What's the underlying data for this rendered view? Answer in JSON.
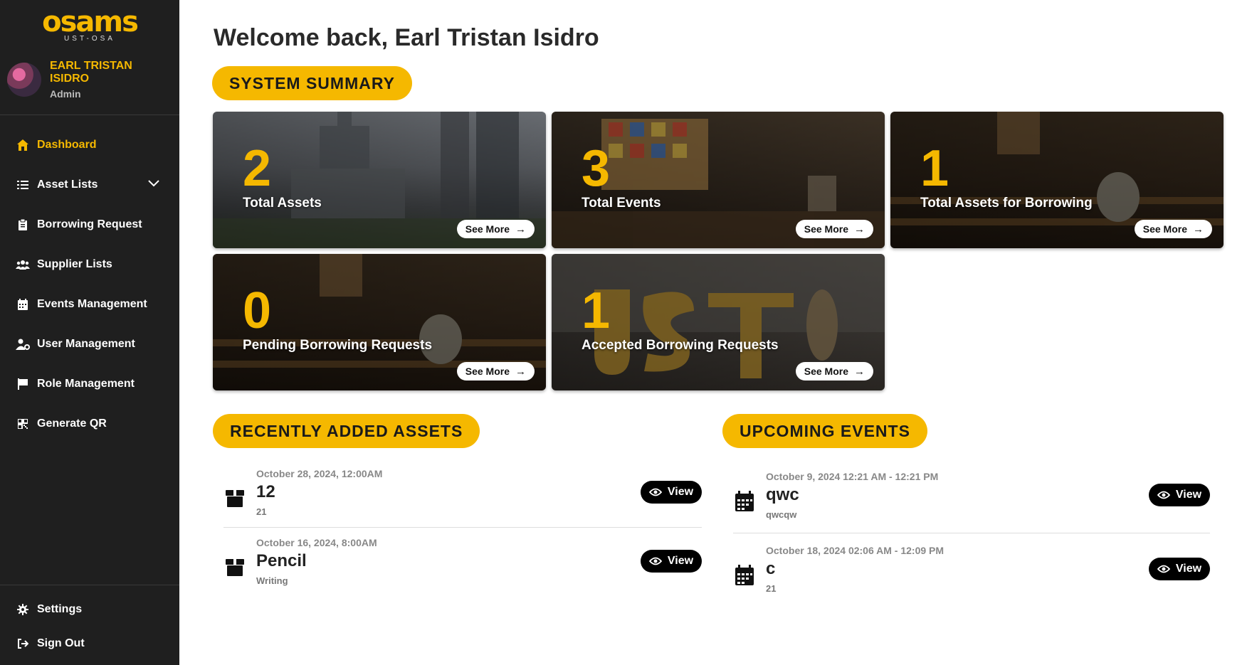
{
  "brand": {
    "logo_text": "osams",
    "logo_sub": "UST-OSA"
  },
  "user": {
    "name": "EARL TRISTAN ISIDRO",
    "role": "Admin"
  },
  "nav": {
    "items": [
      {
        "label": "Dashboard",
        "icon": "home-icon",
        "active": true
      },
      {
        "label": "Asset Lists",
        "icon": "list-icon"
      },
      {
        "label": "Borrowing Request",
        "icon": "clipboard-icon"
      },
      {
        "label": "Supplier Lists",
        "icon": "users-icon"
      },
      {
        "label": "Events Management",
        "icon": "calendar-icon"
      },
      {
        "label": "User Management",
        "icon": "user-gear-icon"
      },
      {
        "label": "Role Management",
        "icon": "flag-icon"
      },
      {
        "label": "Generate QR",
        "icon": "qr-icon"
      }
    ],
    "bottom": [
      {
        "label": "Settings",
        "icon": "gear-icon"
      },
      {
        "label": "Sign Out",
        "icon": "sign-out-icon"
      }
    ]
  },
  "header": {
    "welcome": "Welcome back, Earl Tristan Isidro"
  },
  "summary": {
    "title": "SYSTEM SUMMARY",
    "see_more": "See More",
    "cards": [
      {
        "value": "2",
        "label": "Total Assets"
      },
      {
        "value": "3",
        "label": "Total Events"
      },
      {
        "value": "1",
        "label": "Total Assets for Borrowing"
      },
      {
        "value": "0",
        "label": "Pending Borrowing Requests"
      },
      {
        "value": "1",
        "label": "Accepted Borrowing Requests"
      }
    ]
  },
  "recent_assets": {
    "title": "RECENTLY ADDED ASSETS",
    "view_label": "View",
    "items": [
      {
        "date": "October 28, 2024, 12:00AM",
        "name": "12",
        "sub": "21"
      },
      {
        "date": "October 16, 2024, 8:00AM",
        "name": "Pencil",
        "sub": "Writing"
      }
    ]
  },
  "upcoming_events": {
    "title": "UPCOMING EVENTS",
    "view_label": "View",
    "items": [
      {
        "date": "October 9, 2024 12:21 AM - 12:21 PM",
        "name": "qwc",
        "sub": "qwcqw"
      },
      {
        "date": "October 18, 2024 02:06 AM - 12:09 PM",
        "name": "c",
        "sub": "21"
      }
    ]
  },
  "colors": {
    "accent": "#f5b800",
    "sidebar": "#1f1f1f"
  }
}
